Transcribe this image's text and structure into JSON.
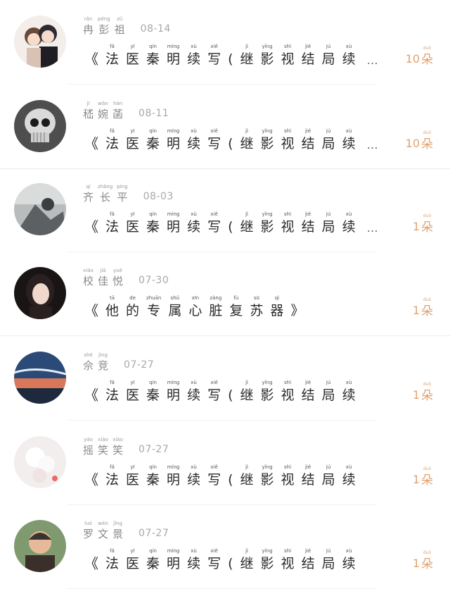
{
  "comments": [
    {
      "name": [
        {
          "py": "rǎn",
          "ch": "冉"
        },
        {
          "py": "péng",
          "ch": "彭"
        },
        {
          "py": "zǔ",
          "ch": "祖"
        }
      ],
      "date": "08-14",
      "title_open": "《",
      "title": [
        {
          "py": "fǎ",
          "ch": "法"
        },
        {
          "py": "yī",
          "ch": "医"
        },
        {
          "py": "qín",
          "ch": "秦"
        },
        {
          "py": "míng",
          "ch": "明"
        },
        {
          "py": "xù",
          "ch": "续"
        },
        {
          "py": "xiě",
          "ch": "写"
        },
        {
          "py": "",
          "ch": "("
        },
        {
          "py": "jì",
          "ch": "继"
        },
        {
          "py": "yǐng",
          "ch": "影"
        },
        {
          "py": "shì",
          "ch": "视"
        },
        {
          "py": "jié",
          "ch": "结"
        },
        {
          "py": "jú",
          "ch": "局"
        },
        {
          "py": "xù",
          "ch": "续"
        }
      ],
      "ellipsis": "…",
      "flower_count": "10",
      "flower_unit": {
        "py": "duǒ",
        "ch": "朵"
      },
      "avatar": "avatar-anime-couple"
    },
    {
      "name": [
        {
          "py": "jī",
          "ch": "嵇"
        },
        {
          "py": "wǎn",
          "ch": "婉"
        },
        {
          "py": "hán",
          "ch": "菡"
        }
      ],
      "date": "08-11",
      "title_open": "《",
      "title": [
        {
          "py": "fǎ",
          "ch": "法"
        },
        {
          "py": "yī",
          "ch": "医"
        },
        {
          "py": "qín",
          "ch": "秦"
        },
        {
          "py": "míng",
          "ch": "明"
        },
        {
          "py": "xù",
          "ch": "续"
        },
        {
          "py": "xiě",
          "ch": "写"
        },
        {
          "py": "",
          "ch": "("
        },
        {
          "py": "jì",
          "ch": "继"
        },
        {
          "py": "yǐng",
          "ch": "影"
        },
        {
          "py": "shì",
          "ch": "视"
        },
        {
          "py": "jié",
          "ch": "结"
        },
        {
          "py": "jú",
          "ch": "局"
        },
        {
          "py": "xù",
          "ch": "续"
        }
      ],
      "ellipsis": "…",
      "flower_count": "10",
      "flower_unit": {
        "py": "duǒ",
        "ch": "朵"
      },
      "avatar": "avatar-skull"
    },
    {
      "name": [
        {
          "py": "qí",
          "ch": "齐"
        },
        {
          "py": "zhǎng",
          "ch": "长"
        },
        {
          "py": "píng",
          "ch": "平"
        }
      ],
      "date": "08-03",
      "title_open": "《",
      "title": [
        {
          "py": "fǎ",
          "ch": "法"
        },
        {
          "py": "yī",
          "ch": "医"
        },
        {
          "py": "qín",
          "ch": "秦"
        },
        {
          "py": "míng",
          "ch": "明"
        },
        {
          "py": "xù",
          "ch": "续"
        },
        {
          "py": "xiě",
          "ch": "写"
        },
        {
          "py": "",
          "ch": "("
        },
        {
          "py": "jì",
          "ch": "继"
        },
        {
          "py": "yǐng",
          "ch": "影"
        },
        {
          "py": "shì",
          "ch": "视"
        },
        {
          "py": "jié",
          "ch": "结"
        },
        {
          "py": "jú",
          "ch": "局"
        },
        {
          "py": "xù",
          "ch": "续"
        }
      ],
      "ellipsis": "…",
      "flower_count": "1",
      "flower_unit": {
        "py": "duǒ",
        "ch": "朵"
      },
      "avatar": "avatar-grey-scene"
    },
    {
      "name": [
        {
          "py": "xiào",
          "ch": "校"
        },
        {
          "py": "jiā",
          "ch": "佳"
        },
        {
          "py": "yuè",
          "ch": "悦"
        }
      ],
      "date": "07-30",
      "title_open": "《",
      "title": [
        {
          "py": "tā",
          "ch": "他"
        },
        {
          "py": "de",
          "ch": "的"
        },
        {
          "py": "zhuān",
          "ch": "专"
        },
        {
          "py": "shǔ",
          "ch": "属"
        },
        {
          "py": "xīn",
          "ch": "心"
        },
        {
          "py": "zàng",
          "ch": "脏"
        },
        {
          "py": "fù",
          "ch": "复"
        },
        {
          "py": "sū",
          "ch": "苏"
        },
        {
          "py": "qì",
          "ch": "器"
        },
        {
          "py": "",
          "ch": "》"
        }
      ],
      "ellipsis": "",
      "flower_count": "1",
      "flower_unit": {
        "py": "duǒ",
        "ch": "朵"
      },
      "avatar": "avatar-girl-portrait"
    },
    {
      "name": [
        {
          "py": "shé",
          "ch": "佘"
        },
        {
          "py": "jìng",
          "ch": "竞"
        }
      ],
      "date": "07-27",
      "title_open": "《",
      "title": [
        {
          "py": "fǎ",
          "ch": "法"
        },
        {
          "py": "yī",
          "ch": "医"
        },
        {
          "py": "qín",
          "ch": "秦"
        },
        {
          "py": "míng",
          "ch": "明"
        },
        {
          "py": "xù",
          "ch": "续"
        },
        {
          "py": "xiě",
          "ch": "写"
        },
        {
          "py": "",
          "ch": "("
        },
        {
          "py": "jì",
          "ch": "继"
        },
        {
          "py": "yǐng",
          "ch": "影"
        },
        {
          "py": "shì",
          "ch": "视"
        },
        {
          "py": "jié",
          "ch": "结"
        },
        {
          "py": "jú",
          "ch": "局"
        },
        {
          "py": "xù",
          "ch": "续"
        }
      ],
      "ellipsis": "",
      "flower_count": "1",
      "flower_unit": {
        "py": "duǒ",
        "ch": "朵"
      },
      "avatar": "avatar-sunset-sky"
    },
    {
      "name": [
        {
          "py": "yáo",
          "ch": "摇"
        },
        {
          "py": "xiào",
          "ch": "笑"
        },
        {
          "py": "xiào",
          "ch": "笑"
        }
      ],
      "date": "07-27",
      "title_open": "《",
      "title": [
        {
          "py": "fǎ",
          "ch": "法"
        },
        {
          "py": "yī",
          "ch": "医"
        },
        {
          "py": "qín",
          "ch": "秦"
        },
        {
          "py": "míng",
          "ch": "明"
        },
        {
          "py": "xù",
          "ch": "续"
        },
        {
          "py": "xiě",
          "ch": "写"
        },
        {
          "py": "",
          "ch": "("
        },
        {
          "py": "jì",
          "ch": "继"
        },
        {
          "py": "yǐng",
          "ch": "影"
        },
        {
          "py": "shì",
          "ch": "视"
        },
        {
          "py": "jié",
          "ch": "结"
        },
        {
          "py": "jú",
          "ch": "局"
        },
        {
          "py": "xù",
          "ch": "续"
        }
      ],
      "ellipsis": "",
      "flower_count": "1",
      "flower_unit": {
        "py": "duǒ",
        "ch": "朵"
      },
      "avatar": "avatar-white-flowers"
    },
    {
      "name": [
        {
          "py": "luó",
          "ch": "罗"
        },
        {
          "py": "wén",
          "ch": "文"
        },
        {
          "py": "jǐng",
          "ch": "景"
        }
      ],
      "date": "07-27",
      "title_open": "《",
      "title": [
        {
          "py": "fǎ",
          "ch": "法"
        },
        {
          "py": "yī",
          "ch": "医"
        },
        {
          "py": "qín",
          "ch": "秦"
        },
        {
          "py": "míng",
          "ch": "明"
        },
        {
          "py": "xù",
          "ch": "续"
        },
        {
          "py": "xiě",
          "ch": "写"
        },
        {
          "py": "",
          "ch": "("
        },
        {
          "py": "jì",
          "ch": "继"
        },
        {
          "py": "yǐng",
          "ch": "影"
        },
        {
          "py": "shì",
          "ch": "视"
        },
        {
          "py": "jié",
          "ch": "结"
        },
        {
          "py": "jú",
          "ch": "局"
        },
        {
          "py": "xù",
          "ch": "续"
        }
      ],
      "ellipsis": "",
      "flower_count": "1",
      "flower_unit": {
        "py": "duǒ",
        "ch": "朵"
      },
      "avatar": "avatar-elder-woman"
    }
  ]
}
